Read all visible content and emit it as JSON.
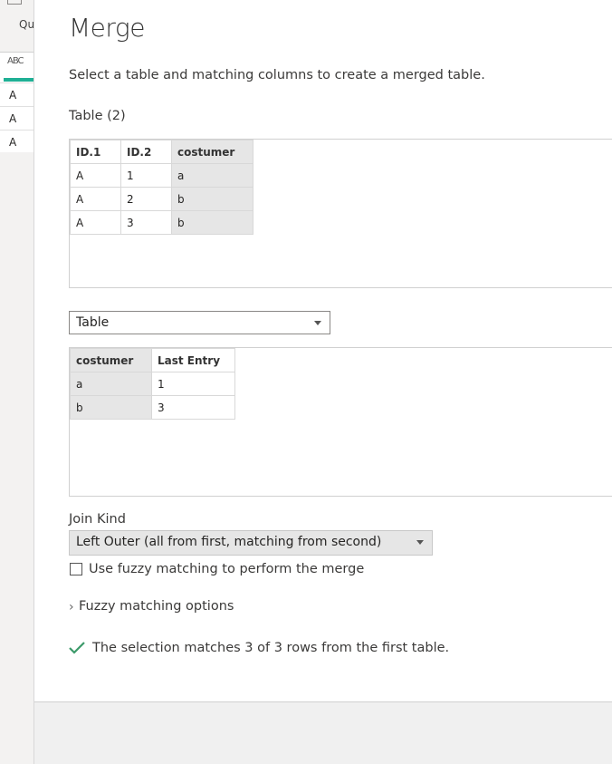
{
  "background": {
    "ribbon_label_partial": "Qu",
    "column_type_icon": "ABC",
    "accent_color": "#1fb095",
    "column_values": [
      "A",
      "A",
      "A"
    ]
  },
  "dialog": {
    "title": "Merge",
    "subtitle": "Select a table and matching columns to create a merged table.",
    "first_table": {
      "label": "Table (2)",
      "columns": [
        "ID.1",
        "ID.2",
        "costumer"
      ],
      "selected_column": "costumer",
      "rows": [
        [
          "A",
          "1",
          "a"
        ],
        [
          "A",
          "2",
          "b"
        ],
        [
          "A",
          "3",
          "b"
        ]
      ]
    },
    "second_table": {
      "selected": "Table",
      "columns": [
        "costumer",
        "Last Entry"
      ],
      "selected_column": "costumer",
      "rows": [
        [
          "a",
          "1"
        ],
        [
          "b",
          "3"
        ]
      ]
    },
    "join_kind": {
      "label": "Join Kind",
      "selected": "Left Outer (all from first, matching from second)"
    },
    "fuzzy": {
      "checkbox_label": "Use fuzzy matching to perform the merge",
      "checked": false,
      "options_label": "Fuzzy matching options"
    },
    "status": {
      "icon": "checkmark-icon",
      "text": "The selection matches 3 of 3 rows from the first table.",
      "color": "#3c9a6a"
    }
  }
}
